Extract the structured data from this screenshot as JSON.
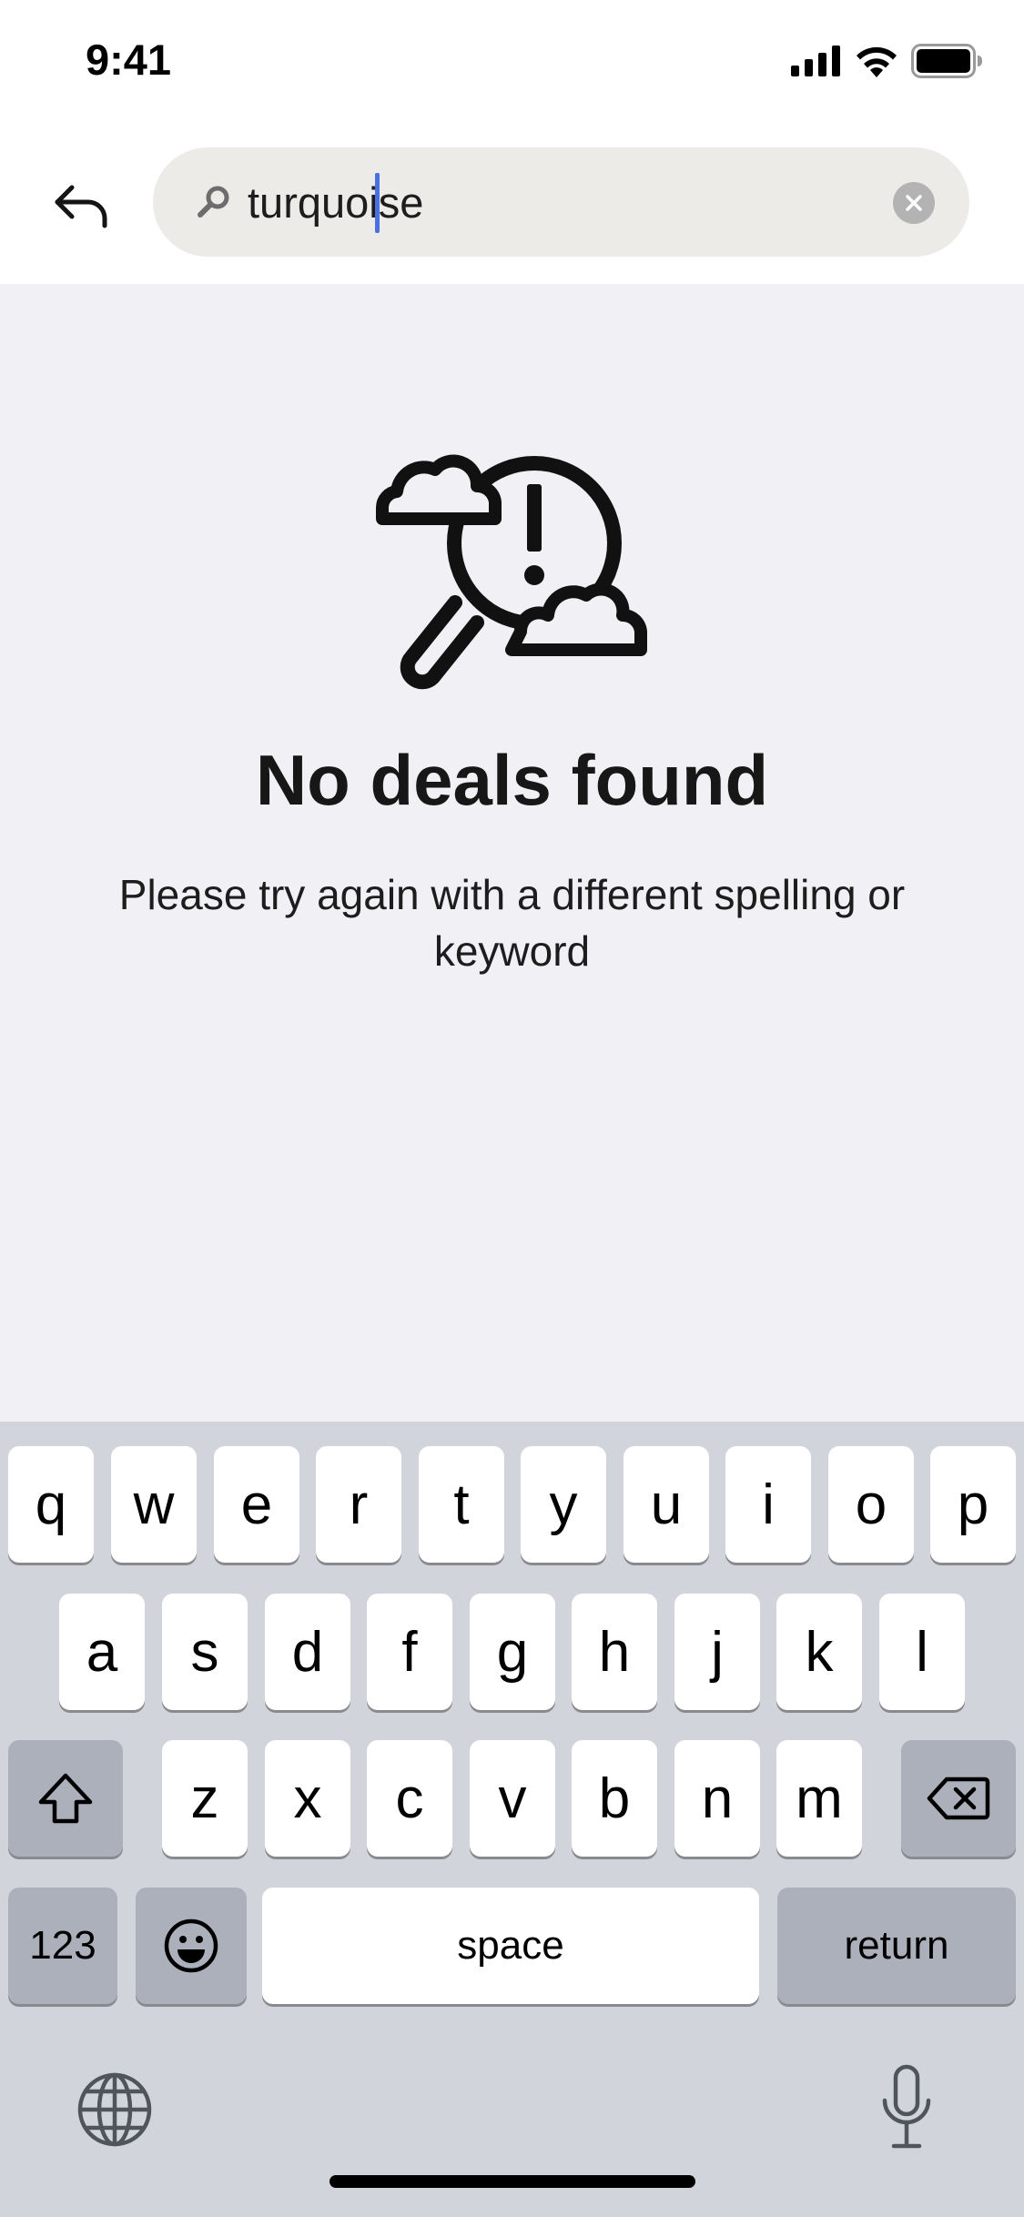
{
  "status_bar": {
    "time": "9:41"
  },
  "search": {
    "query": "turquoise",
    "back_icon": "back-arrow-icon",
    "search_icon": "search-icon",
    "clear_icon": "clear-icon"
  },
  "empty_state": {
    "illustration": "search-alert-icon",
    "title": "No deals found",
    "message": "Please try again with a different spelling or keyword"
  },
  "keyboard": {
    "row1": [
      "q",
      "w",
      "e",
      "r",
      "t",
      "y",
      "u",
      "i",
      "o",
      "p"
    ],
    "row2": [
      "a",
      "s",
      "d",
      "f",
      "g",
      "h",
      "j",
      "k",
      "l"
    ],
    "row3": [
      "z",
      "x",
      "c",
      "v",
      "b",
      "n",
      "m"
    ],
    "numbers_label": "123",
    "space_label": "space",
    "return_label": "return"
  },
  "colors": {
    "background": "#f1f1f5",
    "header": "#ffffff",
    "search_field": "#ecebe7",
    "cursor": "#4a6fe0",
    "keyboard": "#d1d4db"
  }
}
